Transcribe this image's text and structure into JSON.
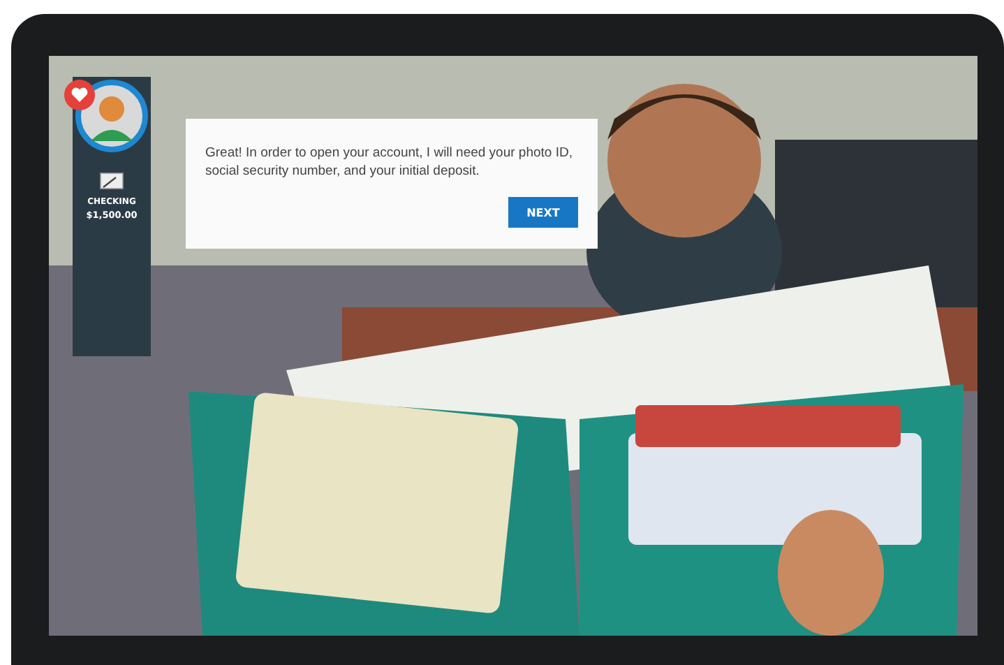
{
  "account_panel": {
    "label": "CHECKING",
    "balance": "$1,500.00"
  },
  "dialog": {
    "message": "Great! In order to open your account, I will need your photo ID, social security number, and your initial deposit.",
    "button": "NEXT"
  }
}
